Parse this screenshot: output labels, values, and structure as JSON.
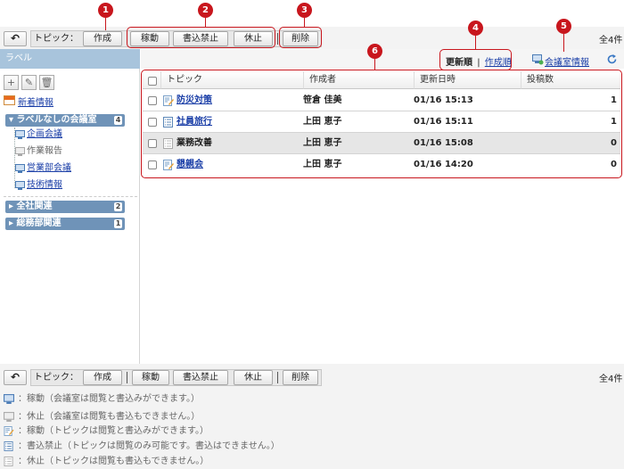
{
  "toolbar": {
    "topic_label": "トピック：",
    "create": "作成",
    "active": "稼動",
    "write_block": "書込禁止",
    "pause": "休止",
    "delete": "削除",
    "total": "全4件"
  },
  "callouts": [
    "1",
    "2",
    "3",
    "4",
    "5",
    "6"
  ],
  "sidebar": {
    "title": "ラベル",
    "news": "新着情報",
    "folder_unlabeled": {
      "label": "ラベルなしの会議室",
      "count": "4"
    },
    "rooms": [
      {
        "label": "企画会議",
        "state": "active"
      },
      {
        "label": "作業報告",
        "state": "paused"
      },
      {
        "label": "営業部会議",
        "state": "active"
      },
      {
        "label": "技術情報",
        "state": "active"
      }
    ],
    "folders": [
      {
        "label": "全社関連",
        "count": "2"
      },
      {
        "label": "総務部関連",
        "count": "1"
      }
    ]
  },
  "sort": {
    "newest": "更新順",
    "sep": "|",
    "created": "作成順"
  },
  "room_info": "会議室情報",
  "table": {
    "headers": {
      "topic": "トピック",
      "author": "作成者",
      "updated": "更新日時",
      "posts": "投稿数"
    },
    "rows": [
      {
        "topic": "防災対策",
        "author": "笹倉 佳美",
        "updated": "01/16 15:13",
        "posts": "1",
        "state": "active",
        "link": true
      },
      {
        "topic": "社員旅行",
        "author": "上田 恵子",
        "updated": "01/16 15:11",
        "posts": "1",
        "state": "write-blocked",
        "link": true
      },
      {
        "topic": "業務改善",
        "author": "上田 恵子",
        "updated": "01/16 15:08",
        "posts": "0",
        "state": "paused",
        "link": false
      },
      {
        "topic": "懇親会",
        "author": "上田 恵子",
        "updated": "01/16 14:20",
        "posts": "0",
        "state": "active",
        "link": true
      }
    ]
  },
  "legend": [
    "：稼動（会議室は閲覧と書込みができます。）",
    "：休止（会議室は閲覧も書込もできません。）",
    "：稼動（トピックは閲覧と書込みができます。）",
    "：書込禁止（トピックは閲覧のみ可能です。書込はできません。）",
    "：休止（トピックは閲覧も書込もできません。）"
  ],
  "colors": {
    "callout": "#c8161d",
    "link": "#1a3ea7",
    "sidebar_head": "#a8c4dc",
    "folder": "#6f93b8"
  }
}
